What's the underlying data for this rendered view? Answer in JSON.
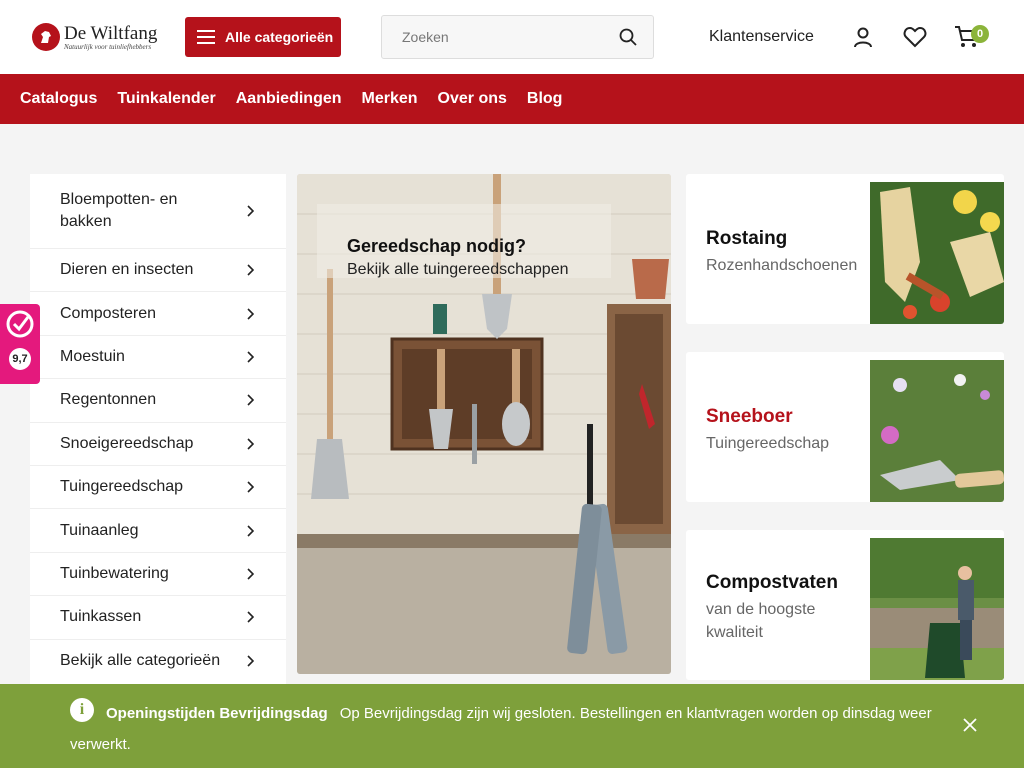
{
  "header": {
    "logo_name": "De Wiltfang",
    "logo_tagline": "Natuurlijk voor tuinliefhebbers",
    "categories_button": "Alle categorieën",
    "search_placeholder": "Zoeken",
    "customer_service": "Klantenservice",
    "cart_count": "0"
  },
  "nav": {
    "items": [
      "Catalogus",
      "Tuinkalender",
      "Aanbiedingen",
      "Merken",
      "Over ons",
      "Blog"
    ]
  },
  "sidebar": {
    "items": [
      "Bloempotten- en bakken",
      "Dieren en insecten",
      "Composteren",
      "Moestuin",
      "Regentonnen",
      "Snoeigereedschap",
      "Tuingereedschap",
      "Tuinaanleg",
      "Tuinbewatering",
      "Tuinkassen",
      "Bekijk alle categorieën"
    ]
  },
  "hero": {
    "title": "Gereedschap nodig?",
    "subtitle": "Bekijk alle tuingereedschappen"
  },
  "promos": [
    {
      "title": "Rostaing",
      "subtitle": "Rozenhandschoenen",
      "title_color": "#111111"
    },
    {
      "title": "Sneeboer",
      "subtitle": "Tuingereedschap",
      "title_color": "#b5121b"
    },
    {
      "title": "Compostvaten",
      "subtitle": "van de hoogste kwaliteit",
      "title_color": "#111111"
    }
  ],
  "rating": {
    "score": "9,7"
  },
  "notice": {
    "title": "Openingstijden Bevrijdingsdag",
    "text": "Op Bevrijdingsdag zijn wij gesloten. Bestellingen en klantvragen worden op dinsdag weer verwerkt."
  },
  "colors": {
    "brand_red": "#b5121b",
    "notice_green": "#7ea03b",
    "rating_pink": "#e4197d"
  }
}
